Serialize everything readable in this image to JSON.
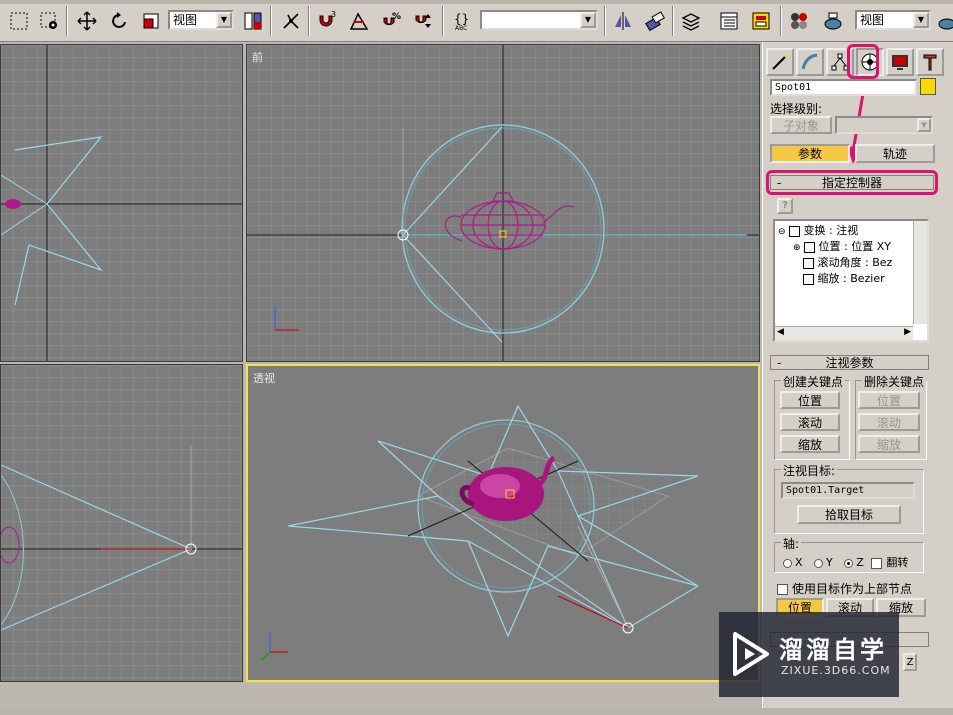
{
  "toolbar": {
    "view_dropdown_1": "视图",
    "view_dropdown_2": "视图",
    "selection_set_value": ""
  },
  "viewports": {
    "front_label": "前",
    "perspective_label": "透视"
  },
  "panel": {
    "object_name": "Spot01",
    "object_color": "#ffd800",
    "selection_level_label": "选择级别:",
    "sub_object_button": "子对象",
    "parameters_tab": "参数",
    "trajectories_tab": "轨迹",
    "assign_controller_title": "指定控制器",
    "help_glyph": "?",
    "tree": {
      "transform": "变换 : 注视",
      "position": "位置 : 位置 XY",
      "roll": "滚动角度 : Bez",
      "scale": "缩放 : Bezier"
    },
    "lookat_params_title": "注视参数",
    "create_key_label": "创建关键点",
    "delete_key_label": "删除关键点",
    "create_position": "位置",
    "create_roll": "滚动",
    "create_scale": "缩放",
    "delete_position": "位置",
    "delete_roll": "滚动",
    "delete_scale": "缩放",
    "lookat_target_label": "注视目标:",
    "target_name": "Spot01.Target",
    "pick_target_button": "拾取目标",
    "axis_label": "轴:",
    "axis_x": "X",
    "axis_y": "Y",
    "axis_z": "Z",
    "flip_label": "翻转",
    "use_target_parent_label": "使用目标作为上部节点",
    "bottom_position": "位置",
    "bottom_roll": "滚动",
    "bottom_scale": "缩放",
    "partial_z": "Z"
  },
  "highlight_color": "#e0106e",
  "watermark": {
    "title": "溜溜自学",
    "subtitle": "ZIXUE.3D66.COM"
  }
}
